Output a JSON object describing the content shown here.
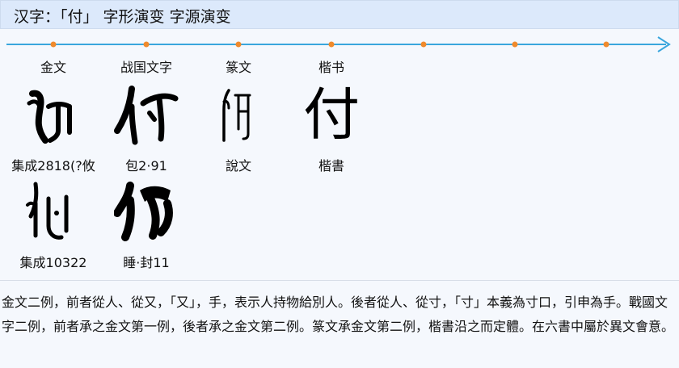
{
  "header": {
    "title": "汉字：「付」 字形演变 字源演变"
  },
  "timeline": {
    "periods": [
      "金文",
      "战国文字",
      "篆文",
      "楷书"
    ],
    "accent_color": "#3aa6dd",
    "marker_color": "#f08a2c"
  },
  "glyphs": [
    {
      "period": "金文",
      "caption": "集成2818(?攸"
    },
    {
      "period": "战国文字",
      "caption": "包2·91"
    },
    {
      "period": "篆文",
      "caption": "說文"
    },
    {
      "period": "楷书",
      "caption": "楷書",
      "character": "付"
    },
    {
      "period": "金文",
      "caption": "集成10322"
    },
    {
      "period": "战国文字",
      "caption": "睡·封11"
    }
  ],
  "description": "金文二例，前者從人、從又，「又」，手，表示人持物給別人。後者從人、從寸，「寸」本義為寸口，引申為手。戰國文字二例，前者承之金文第一例，後者承之金文第二例。篆文承金文第二例，楷書沿之而定體。在六書中屬於異文會意。"
}
